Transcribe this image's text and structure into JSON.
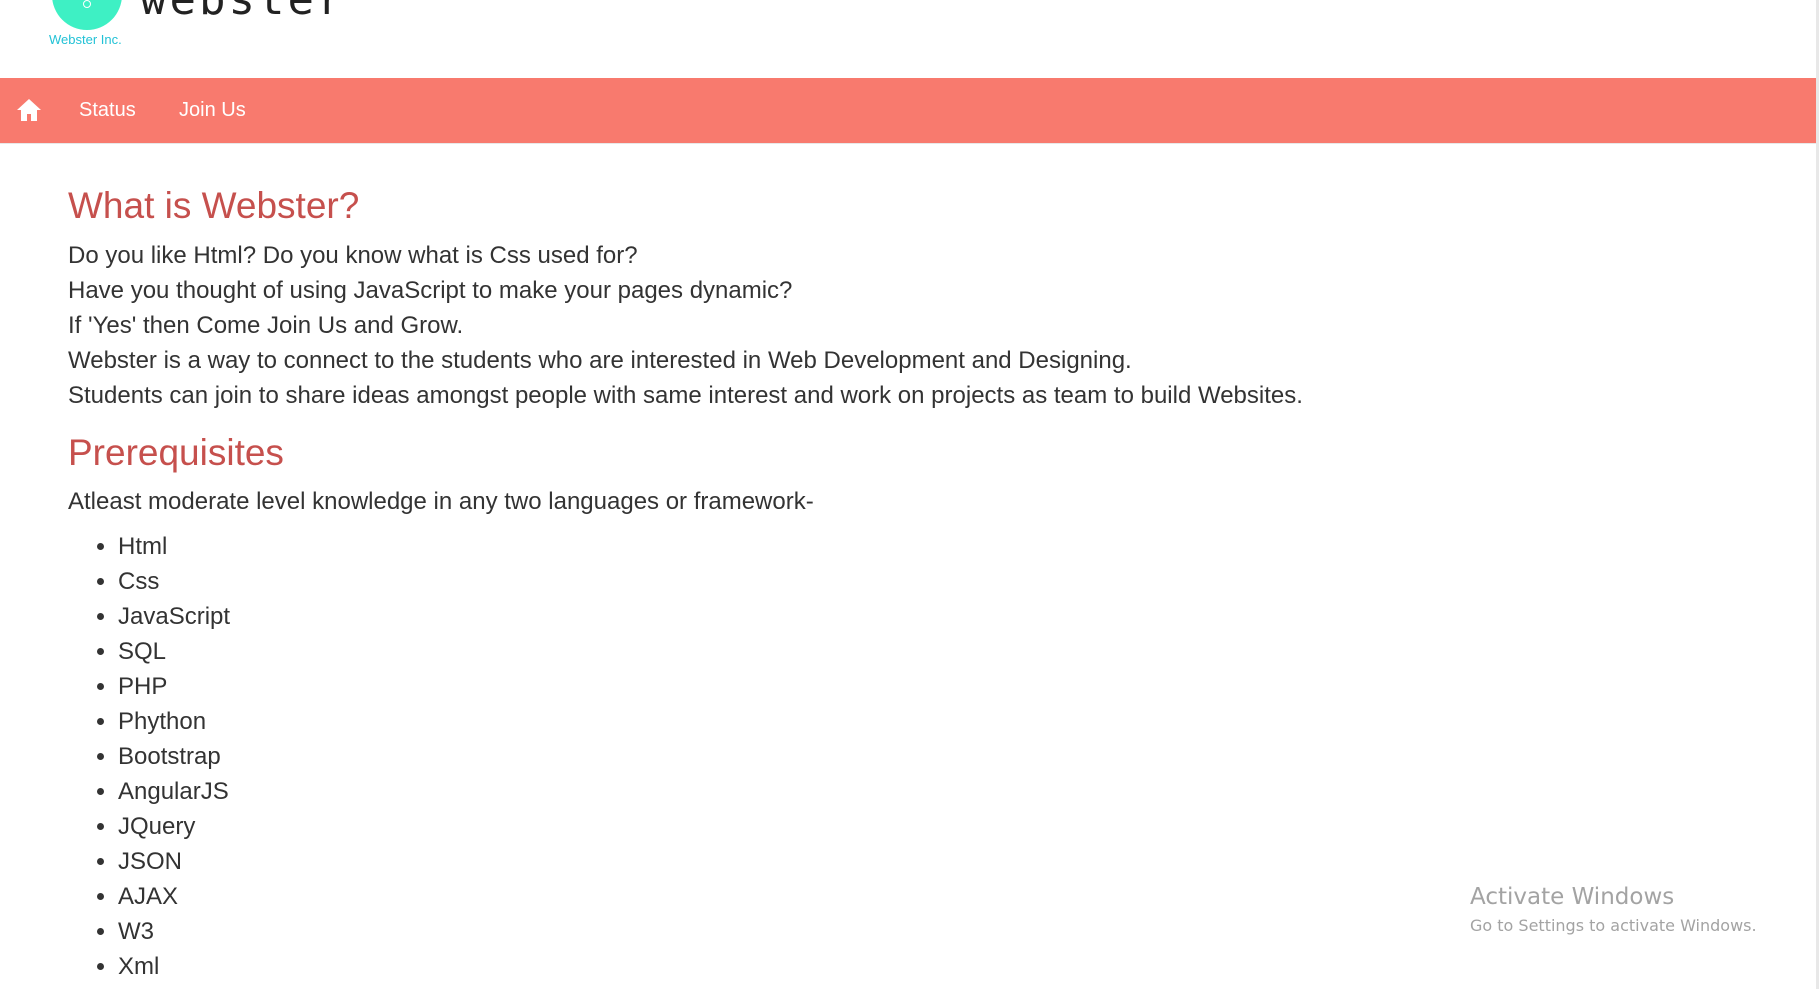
{
  "header": {
    "logo_word": "webster",
    "logo_sub": "Webster Inc."
  },
  "nav": {
    "home_icon": "home-icon",
    "items": [
      {
        "label": "Status"
      },
      {
        "label": "Join Us"
      }
    ]
  },
  "main": {
    "about_title": "What is Webster?",
    "about_lines": [
      "Do you like Html? Do you know what is Css used for?",
      "Have you thought of using JavaScript to make your pages dynamic?",
      "If 'Yes' then Come Join Us and Grow.",
      "Webster is a way to connect to the students who are interested in Web Development and Designing.",
      "Students can join to share ideas amongst people with same interest and work on projects as team to build Websites."
    ],
    "prereq_title": "Prerequisites",
    "prereq_desc": "Atleast moderate level knowledge in any two languages or framework-",
    "languages": [
      "Html",
      "Css",
      "JavaScript",
      "SQL",
      "PHP",
      "Phython",
      "Bootstrap",
      "AngularJS",
      "JQuery",
      "JSON",
      "AJAX",
      "W3",
      "Xml"
    ]
  },
  "watermark": {
    "title": "Activate Windows",
    "subtitle": "Go to Settings to activate Windows."
  },
  "colors": {
    "nav_bg": "#f87a6e",
    "heading": "#c6504d",
    "logo_circle": "#3ef0c4",
    "logo_sub": "#22c2d6"
  }
}
